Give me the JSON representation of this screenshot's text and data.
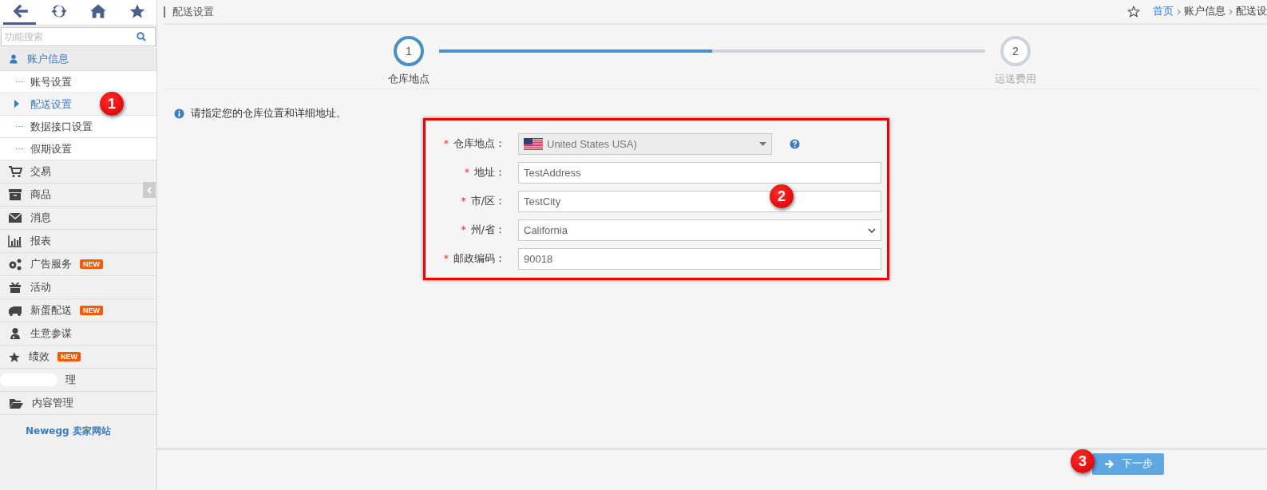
{
  "toolbar": [
    {
      "kind": "back",
      "selected": true
    },
    {
      "kind": "refresh",
      "selected": false
    },
    {
      "kind": "home",
      "selected": false
    },
    {
      "kind": "star",
      "selected": false
    }
  ],
  "search": {
    "placeholder": "功能搜索"
  },
  "menu": [
    {
      "kind": "user",
      "label": "账户信息",
      "expanded": true,
      "children": [
        {
          "label": "账号设置",
          "selected": false
        },
        {
          "label": "配送设置",
          "selected": true
        },
        {
          "label": "数据接口设置",
          "selected": false
        },
        {
          "label": "假期设置",
          "selected": false
        }
      ]
    },
    {
      "kind": "cart",
      "label": "交易"
    },
    {
      "kind": "archive",
      "label": "商品"
    },
    {
      "kind": "envelope",
      "label": "消息"
    },
    {
      "kind": "chart",
      "label": "报表"
    },
    {
      "kind": "gears",
      "label": "广告服务",
      "badge": "NEW"
    },
    {
      "kind": "gift",
      "label": "活动"
    },
    {
      "kind": "truck",
      "label": "新蛋配送",
      "badge": "NEW"
    },
    {
      "kind": "advisor",
      "label": "生意参谋"
    },
    {
      "kind": "star",
      "label": "绩效",
      "badge": "NEW"
    },
    {
      "kind": "redacted",
      "label": "理"
    },
    {
      "kind": "folder",
      "label": "内容管理"
    }
  ],
  "brand": "Newegg 卖家网站",
  "page_title": "配送设置",
  "breadcrumb": [
    "首页",
    "账户信息",
    "配送设"
  ],
  "stepper": {
    "level": 0.5,
    "steps": [
      {
        "number": "1",
        "label": "仓库地点",
        "selected": true
      },
      {
        "number": "2",
        "label": "运送费用",
        "selected": false
      }
    ]
  },
  "notice": "请指定您的仓库位置和详细地址。",
  "form": [
    {
      "kind": "country",
      "required_mark": "*",
      "label": "仓库地点：",
      "value": "United States USA)",
      "disabled": true
    },
    {
      "kind": "text",
      "required_mark": "*",
      "label": "地址：",
      "value": "TestAddress"
    },
    {
      "kind": "text",
      "required_mark": "*",
      "label": "市/区：",
      "value": "TestCity"
    },
    {
      "kind": "select",
      "required_mark": "*",
      "label": "州/省：",
      "value": "California"
    },
    {
      "kind": "text",
      "required_mark": "*",
      "label": "邮政编码：",
      "value": "90018"
    }
  ],
  "next_button": "下一步",
  "callouts": [
    "1",
    "2",
    "3"
  ]
}
